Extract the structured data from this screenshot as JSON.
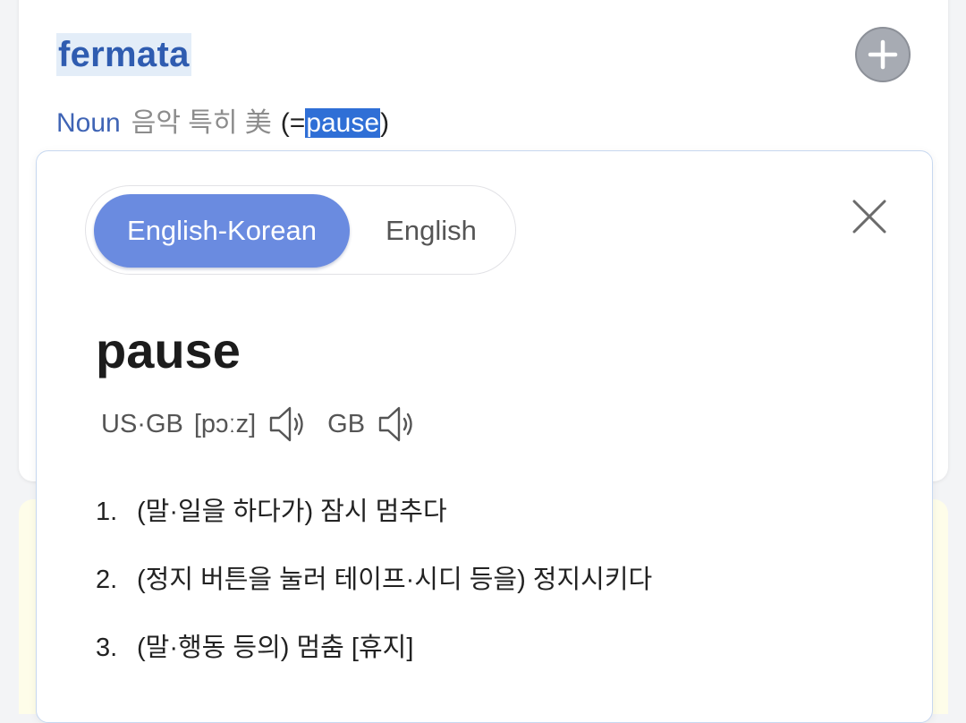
{
  "entry": {
    "headword": "fermata",
    "part_of_speech": "Noun",
    "tags": "음악 특히 美",
    "ref_prefix": "(=",
    "ref_word": "pause",
    "ref_suffix": ")",
    "add_icon": "plus-icon"
  },
  "popup": {
    "tabs": [
      {
        "label": "English-Korean",
        "active": true
      },
      {
        "label": "English",
        "active": false
      }
    ],
    "close_icon": "close-icon",
    "word": "pause",
    "pronunciation": {
      "us_gb_label": "US·GB",
      "ipa": "[pɔːz]",
      "gb_label": "GB",
      "speaker_icon": "speaker-icon"
    },
    "definitions": [
      {
        "num": "1.",
        "text": "(말·일을 하다가) 잠시 멈추다"
      },
      {
        "num": "2.",
        "text": "(정지 버튼을 눌러 테이프·시디 등을) 정지시키다"
      },
      {
        "num": "3.",
        "text": "(말·행동 등의) 멈춤 [휴지]"
      }
    ]
  },
  "colors": {
    "accent": "#6a8be0",
    "headword": "#2f5cb0",
    "highlight": "#2f6fd6",
    "strip": "#fefde9"
  }
}
